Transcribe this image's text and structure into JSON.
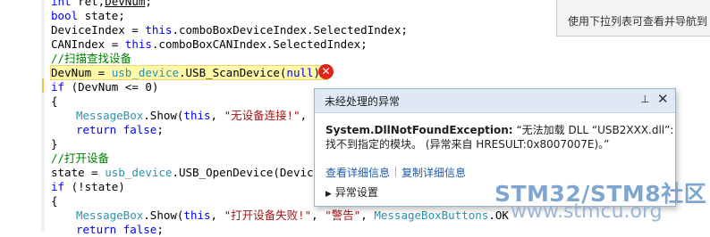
{
  "code_lines": [
    "int ret,DevNum;",
    "bool state;",
    "DeviceIndex = this.comboBoxDeviceIndex.SelectedIndex;",
    "CANIndex = this.comboBoxCANIndex.SelectedIndex;",
    "//扫描查找设备",
    "DevNum = usb_device.USB_ScanDevice(null);",
    "if (DevNum <= 0)",
    "{",
    "MessageBox.Show(this, \"无设备连接!\",",
    "return false;",
    "}",
    "//打开设备",
    "state = usb_device.USB_OpenDevice(DeviceIn",
    "if (!state)",
    "{",
    "MessageBox.Show(this, \"打开设备失败!\", \"警告\", MessageBoxButtons.OK",
    "return false;"
  ],
  "tooltip_hint": "使用下拉列表可查看并导航到",
  "exception_popup": {
    "title": "未经处理的异常",
    "exception_type": "System.DllNotFoundException:",
    "message_part1": "“无法加载 DLL “USB2XXX.dll”:",
    "message_part2": "找不到指定的模块。 (异常来自 HRESULT:0x8007007E)。”",
    "link_view_details": "查看详细信息",
    "link_copy_details": "复制详细信息",
    "settings_label": "异常设置"
  },
  "watermark": {
    "brand": "STM32/STM8社区",
    "url": "www.stmcu.org"
  },
  "colors": {
    "comment": "#008000",
    "keyword": "#0000ff",
    "type": "#2b91af",
    "string": "#a31515",
    "error": "#e0251b",
    "popup_header": "#dfe8f5",
    "link": "#1e5aa8"
  }
}
